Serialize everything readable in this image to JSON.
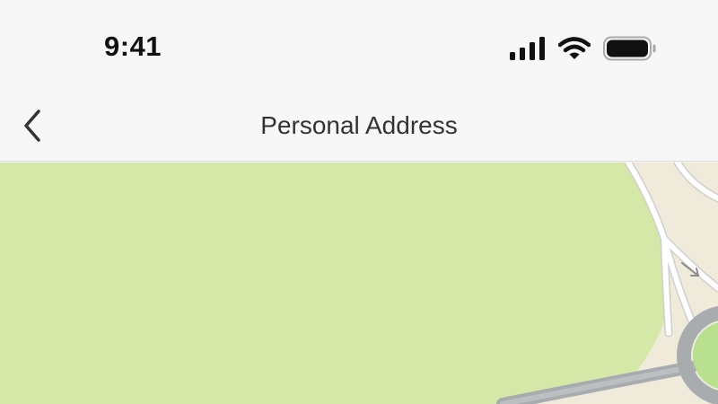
{
  "status_bar": {
    "time": "9:41",
    "icons": [
      "signal-icon",
      "wifi-icon",
      "battery-icon"
    ]
  },
  "nav_bar": {
    "back_icon": "chevron-left-icon",
    "title": "Personal Address"
  },
  "map": {
    "colors": {
      "park": "#d6e8a8",
      "land": "#efead9",
      "road": "#ffffff",
      "road_edge": "#c8c8c8",
      "ring_road": "#a9acae",
      "roundabout_center": "#b8e08e"
    }
  }
}
